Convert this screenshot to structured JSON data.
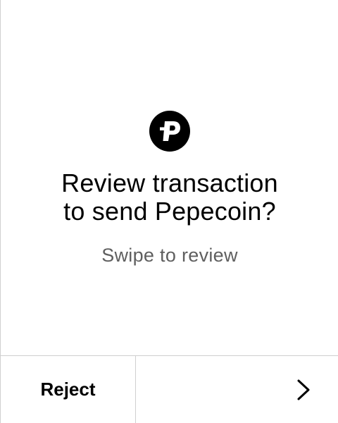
{
  "review": {
    "coin_icon": "pepecoin-logo-icon",
    "title_line1": "Review transaction",
    "title_line2": "to send Pepecoin?",
    "subtitle": "Swipe to review"
  },
  "footer": {
    "reject_label": "Reject",
    "next_icon": "chevron-right-icon"
  },
  "colors": {
    "text": "#000000",
    "subtext": "#5f5f5f",
    "divider": "#cfcfcf",
    "background": "#ffffff"
  }
}
